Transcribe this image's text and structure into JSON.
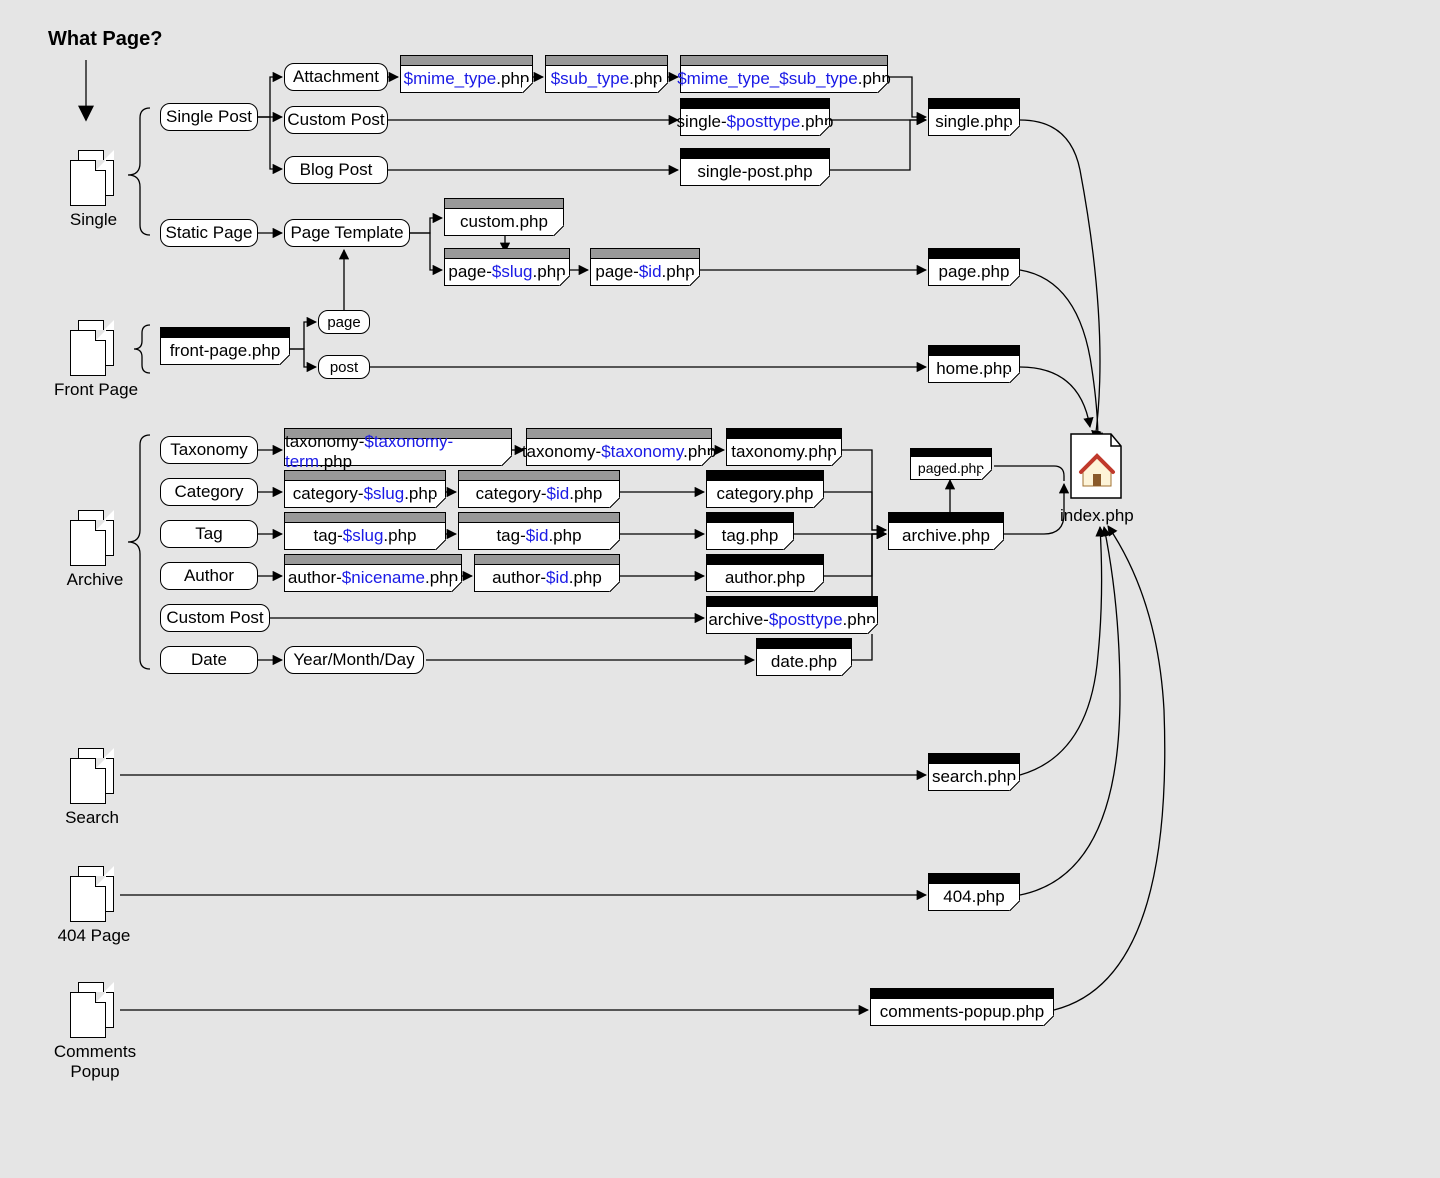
{
  "title": "What Page?",
  "sections": {
    "single": {
      "label": "Single"
    },
    "front_page": {
      "label": "Front Page"
    },
    "archive": {
      "label": "Archive"
    },
    "search": {
      "label": "Search"
    },
    "p404": {
      "label": "404 Page"
    },
    "comments": {
      "label": "Comments Popup"
    }
  },
  "caps": {
    "single_post": "Single Post",
    "static_page": "Static Page",
    "attachment": "Attachment",
    "custom_post_single": "Custom Post",
    "blog_post": "Blog Post",
    "page_template": "Page Template",
    "page_small": "page",
    "post_small": "post",
    "taxonomy": "Taxonomy",
    "category": "Category",
    "tag": "Tag",
    "author": "Author",
    "custom_post_archive": "Custom Post",
    "date": "Date",
    "ymd": "Year/Month/Day"
  },
  "tpl": {
    "mime": {
      "pre": "",
      "var": "$mime_type",
      "suf": ".php"
    },
    "sub": {
      "pre": "",
      "var": "$sub_type",
      "suf": ".php"
    },
    "mimesub": {
      "pre": "",
      "var": "$mime_type_$sub_type",
      "suf": ".php"
    },
    "single_posttype": {
      "pre": "single-",
      "var": "$posttype",
      "suf": ".php"
    },
    "single_post_php": {
      "pre": "single-post.php",
      "var": "",
      "suf": ""
    },
    "single_php": {
      "pre": "single.php",
      "var": "",
      "suf": ""
    },
    "custom_php": {
      "pre": "custom.php",
      "var": "",
      "suf": ""
    },
    "page_slug": {
      "pre": "page-",
      "var": "$slug",
      "suf": ".php"
    },
    "page_id": {
      "pre": "page-",
      "var": "$id",
      "suf": ".php"
    },
    "page_php": {
      "pre": "page.php",
      "var": "",
      "suf": ""
    },
    "front_page_php": {
      "pre": "front-page.php",
      "var": "",
      "suf": ""
    },
    "home_php": {
      "pre": "home.php",
      "var": "",
      "suf": ""
    },
    "tax_term": {
      "pre": "taxonomy-",
      "var": "$taxonomy-term",
      "suf": ".php"
    },
    "tax_tax": {
      "pre": "taxonomy-",
      "var": "$taxonomy",
      "suf": ".php"
    },
    "taxonomy_php": {
      "pre": "taxonomy.php",
      "var": "",
      "suf": ""
    },
    "cat_slug": {
      "pre": "category-",
      "var": "$slug",
      "suf": ".php"
    },
    "cat_id": {
      "pre": "category-",
      "var": "$id",
      "suf": ".php"
    },
    "category_php": {
      "pre": "category.php",
      "var": "",
      "suf": ""
    },
    "tag_slug": {
      "pre": "tag-",
      "var": "$slug",
      "suf": ".php"
    },
    "tag_id": {
      "pre": "tag-",
      "var": "$id",
      "suf": ".php"
    },
    "tag_php": {
      "pre": "tag.php",
      "var": "",
      "suf": ""
    },
    "auth_nice": {
      "pre": "author-",
      "var": "$nicename",
      "suf": ".php"
    },
    "auth_id": {
      "pre": "author-",
      "var": "$id",
      "suf": ".php"
    },
    "author_php": {
      "pre": "author.php",
      "var": "",
      "suf": ""
    },
    "archive_posttype": {
      "pre": "archive-",
      "var": "$posttype",
      "suf": ".php"
    },
    "date_php": {
      "pre": "date.php",
      "var": "",
      "suf": ""
    },
    "archive_php": {
      "pre": "archive.php",
      "var": "",
      "suf": ""
    },
    "paged_php": {
      "pre": "paged.php",
      "var": "",
      "suf": ""
    },
    "search_php": {
      "pre": "search.php",
      "var": "",
      "suf": ""
    },
    "e404_php": {
      "pre": "404.php",
      "var": "",
      "suf": ""
    },
    "comments_php": {
      "pre": "comments-popup.php",
      "var": "",
      "suf": ""
    },
    "index_php": {
      "pre": "index.php",
      "var": "",
      "suf": ""
    }
  }
}
